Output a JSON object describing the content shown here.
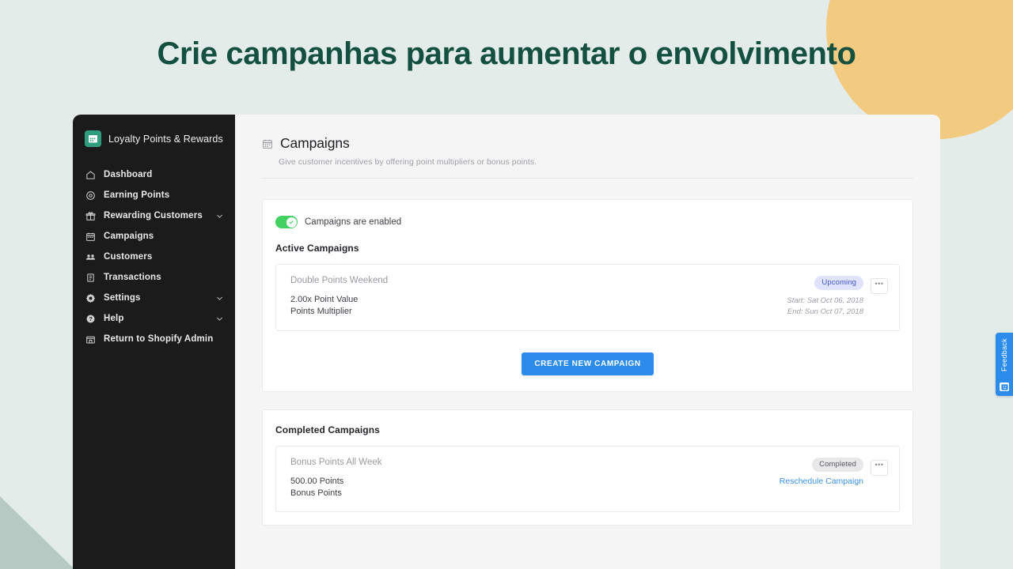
{
  "hero": {
    "title": "Crie campanhas para aumentar o envolvimento"
  },
  "colors": {
    "page_background": "#e4ecea",
    "hero_text": "#14503f",
    "deco_circle": "#f2cb80",
    "deco_triangle": "#b6c9c2",
    "sidebar_background": "#1b1b1b",
    "brand_accent": "#2f9e7e",
    "primary_button": "#2c8ceb",
    "toggle_on": "#44d063",
    "badge_upcoming_bg": "#dfe3fb",
    "badge_upcoming_text": "#4556cc",
    "badge_completed_bg": "#e8e8ea",
    "link_blue": "#3b93e8"
  },
  "sidebar": {
    "brand_name": "Loyalty Points & Rewards",
    "brand_icon": "calendar-app-logo-icon",
    "items": [
      {
        "label": "Dashboard",
        "icon": "home-icon",
        "chevron": false
      },
      {
        "label": "Earning Points",
        "icon": "target-icon",
        "chevron": false
      },
      {
        "label": "Rewarding Customers",
        "icon": "gift-icon",
        "chevron": true
      },
      {
        "label": "Campaigns",
        "icon": "calendar-icon",
        "chevron": false
      },
      {
        "label": "Customers",
        "icon": "people-icon",
        "chevron": false
      },
      {
        "label": "Transactions",
        "icon": "list-icon",
        "chevron": false
      },
      {
        "label": "Settings",
        "icon": "gear-icon",
        "chevron": true
      },
      {
        "label": "Help",
        "icon": "help-circle-icon",
        "chevron": true
      },
      {
        "label": "Return to Shopify Admin",
        "icon": "store-icon",
        "chevron": false
      }
    ]
  },
  "page": {
    "icon": "calendar-icon",
    "title": "Campaigns",
    "subtitle": "Give customer incentives by offering point multipliers or bonus points."
  },
  "campaigns_panel": {
    "toggle": {
      "label": "Campaigns are enabled",
      "enabled": true,
      "icon": "check-icon"
    },
    "active_section_title": "Active Campaigns",
    "active_campaigns": [
      {
        "name": "Double Points Weekend",
        "value": "2.00x Point Value",
        "type": "Points Multiplier",
        "badge": "Upcoming",
        "start": "Start: Sat Oct 06, 2018",
        "end": "End: Sun Oct 07, 2018",
        "menu_icon": "kebab-menu-icon",
        "menu_dots": "•••"
      }
    ],
    "create_button": "CREATE NEW CAMPAIGN"
  },
  "completed_panel": {
    "section_title": "Completed Campaigns",
    "completed_campaigns": [
      {
        "name": "Bonus Points All Week",
        "value": "500.00 Points",
        "type": "Bonus Points",
        "badge": "Completed",
        "action_link": "Reschedule Campaign",
        "menu_icon": "kebab-menu-icon",
        "menu_dots": "•••"
      }
    ]
  },
  "feedback": {
    "label": "Feedback",
    "icon": "feedback-face-icon"
  }
}
